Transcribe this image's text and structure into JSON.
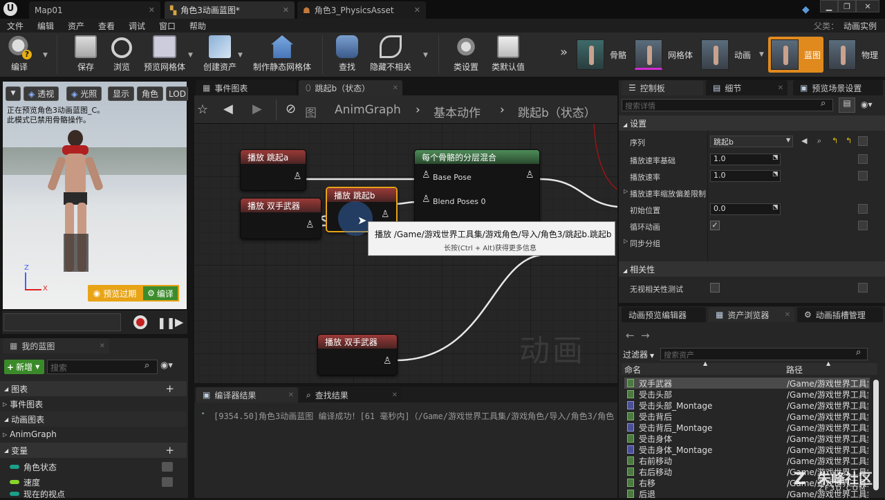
{
  "titlebar": {
    "tabs": [
      "Map01",
      "角色3动画蓝图*",
      "角色3_PhysicsAsset"
    ],
    "ue_logo": "U"
  },
  "menu": {
    "items": [
      "文件",
      "编辑",
      "资产",
      "查看",
      "调试",
      "窗口",
      "帮助"
    ],
    "parent_label": "父类：",
    "parent_value": "动画实例"
  },
  "toolbar": {
    "buttons": [
      "编译",
      "保存",
      "浏览",
      "预览网格体",
      "创建资产",
      "制作静态网格体",
      "查找",
      "隐藏不相关",
      "类设置",
      "类默认值"
    ],
    "modes": [
      "骨骼",
      "网格体",
      "动画",
      "蓝图",
      "物理"
    ]
  },
  "viewport": {
    "buttons": [
      "透视",
      "光照",
      "显示",
      "角色",
      "LOD"
    ],
    "info": [
      "正在预览角色3动画蓝图_C。",
      "此模式已禁用骨骼操作。"
    ],
    "preview_btn": "预览过期",
    "compile_btn": "编译",
    "axis_z": "Z",
    "axis_x": "X"
  },
  "my_blueprint": {
    "tab": "我的蓝图",
    "new_btn": "新增",
    "search_placeholder": "搜索",
    "sections": {
      "graphs": "图表",
      "event_graph": "事件图表",
      "anim_graphs": "动画图表",
      "anim_graph": "AnimGraph",
      "variables": "变量"
    },
    "variables": [
      "角色状态",
      "速度",
      "现在的视点"
    ]
  },
  "graph": {
    "tabs": [
      "事件图表",
      "跳起b（状态）"
    ],
    "breadcrumb": [
      "图",
      "AnimGraph",
      "基本动作",
      "跳起b（状态）"
    ],
    "watermark": "动画"
  },
  "nodes": {
    "play_a": "播放 跳起a",
    "play_dual_1": "播放 双手武器",
    "play_b": "播放 跳起b",
    "blend": "每个骨骼的分层混合",
    "base_pose": "Base Pose",
    "blend_poses": "Blend Poses 0",
    "play_dual_2": "播放 双手武器"
  },
  "tooltip": {
    "line1": "播放 /Game/游戏世界工具集/游戏角色/导入/角色3/跳起b.跳起b",
    "line2": "长按(Ctrl + Alt)获得更多信息"
  },
  "bottom": {
    "tabs": [
      "编译器结果",
      "查找结果"
    ],
    "log": "[9354.50]角色3动画蓝图 编译成功！[61 毫秒内]（/Game/游戏世界工具集/游戏角色/导入/角色3/角色"
  },
  "details": {
    "tabs": [
      "控制板",
      "细节",
      "预览场景设置"
    ],
    "search_placeholder": "搜索详情",
    "section_settings": "设置",
    "rows": [
      {
        "label": "序列",
        "value": "跳起b"
      },
      {
        "label": "播放速率基础",
        "value": "1.0"
      },
      {
        "label": "播放速率",
        "value": "1.0"
      },
      {
        "label": "播放速率缩放偏差限制",
        "value": ""
      },
      {
        "label": "初始位置",
        "value": "0.0"
      },
      {
        "label": "循环动画",
        "value": ""
      },
      {
        "label": "同步分组",
        "value": ""
      }
    ],
    "section_relevancy": "相关性",
    "ignore_relevancy": "无视相关性测试"
  },
  "assets": {
    "tabs": [
      "动画预览编辑器",
      "资产浏览器",
      "动画插槽管理"
    ],
    "filter": "过滤器",
    "search_placeholder": "搜索资产",
    "col_name": "命名",
    "col_path": "路径",
    "items": [
      {
        "name": "双手武器",
        "path": "/Game/游戏世界工具集",
        "m": false
      },
      {
        "name": "受击头部",
        "path": "/Game/游戏世界工具集",
        "m": false
      },
      {
        "name": "受击头部_Montage",
        "path": "/Game/游戏世界工具集",
        "m": true
      },
      {
        "name": "受击背后",
        "path": "/Game/游戏世界工具集",
        "m": false
      },
      {
        "name": "受击背后_Montage",
        "path": "/Game/游戏世界工具集",
        "m": true
      },
      {
        "name": "受击身体",
        "path": "/Game/游戏世界工具集",
        "m": false
      },
      {
        "name": "受击身体_Montage",
        "path": "/Game/游戏世界工具集",
        "m": true
      },
      {
        "name": "右前移动",
        "path": "/Game/游戏世界工具集",
        "m": false
      },
      {
        "name": "右后移动",
        "path": "/Game/游戏世界工具集",
        "m": false
      },
      {
        "name": "右移",
        "path": "/Game/游戏世界工具集",
        "m": false
      },
      {
        "name": "后退",
        "path": "/Game/游戏世界工具集",
        "m": false
      }
    ]
  },
  "brand": {
    "name": "朱峰社区",
    "url": "ZF3D.COM"
  }
}
